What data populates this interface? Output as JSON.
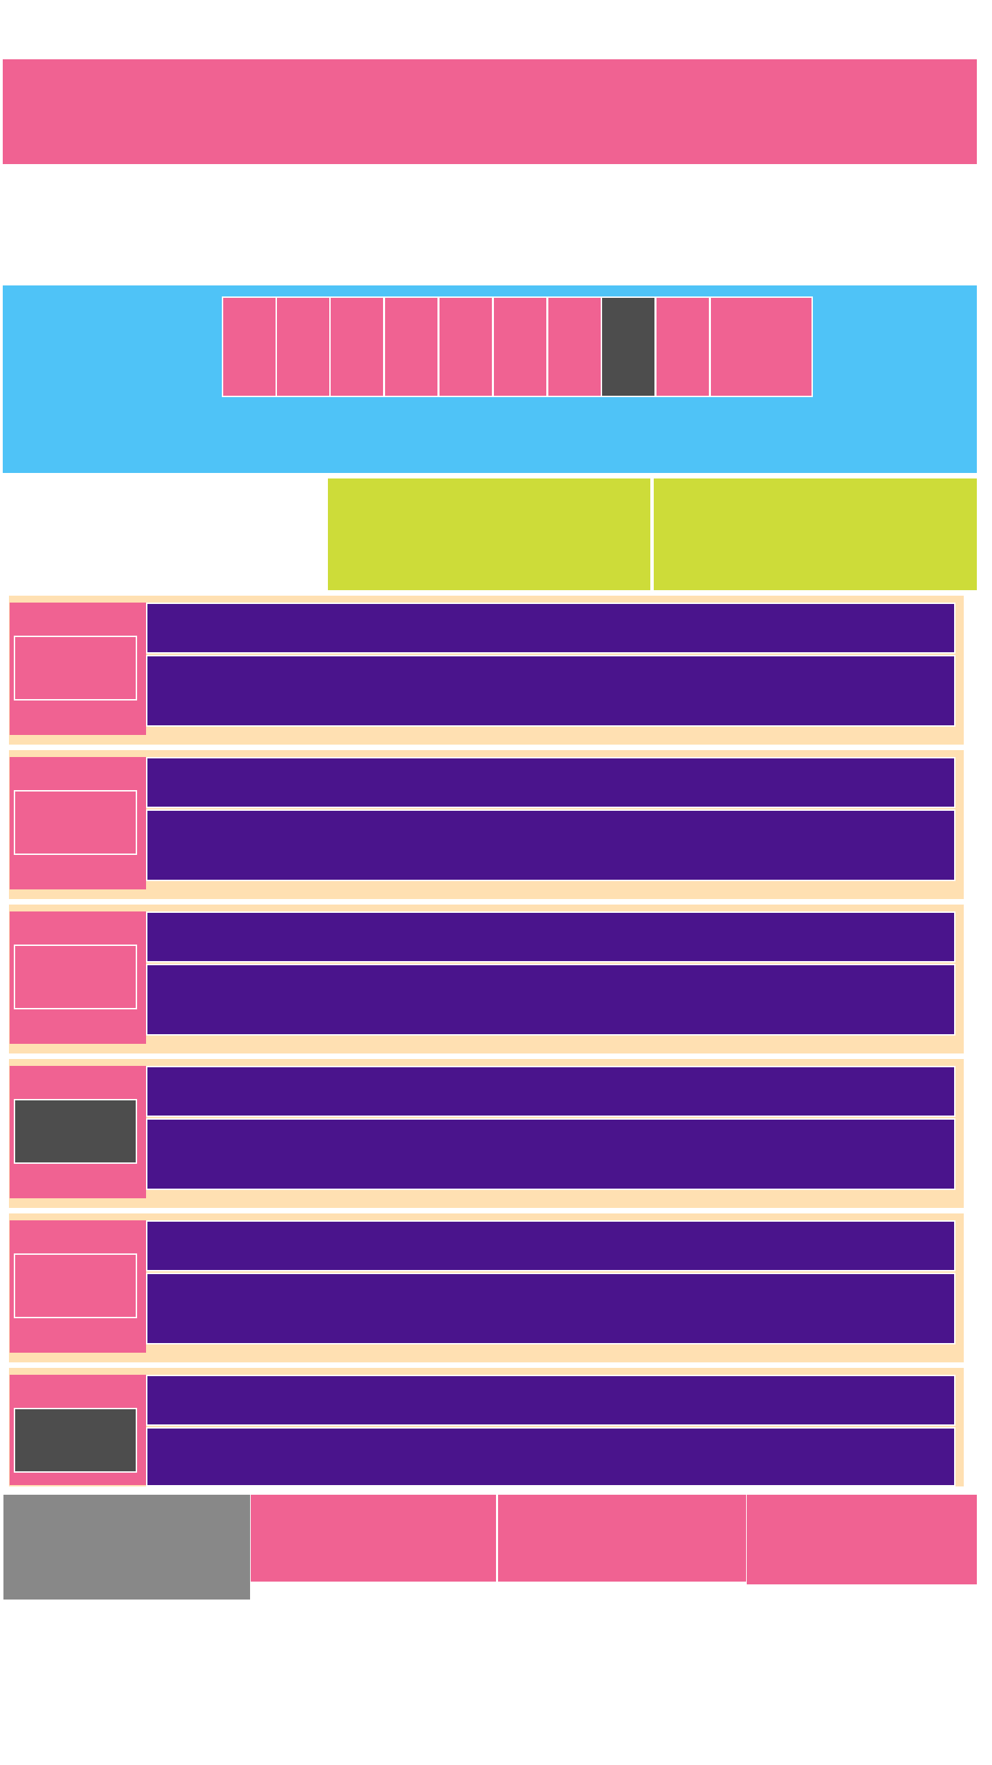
{
  "colors": {
    "pink": "#f06292",
    "sky": "#4fc3f7",
    "lime": "#cddc39",
    "peach": "#ffe0b2",
    "purple": "#4a148c",
    "dark": "#4d4d4d",
    "gray": "#888888"
  },
  "pagination": {
    "page_count": 10,
    "active_index": 7
  },
  "list": {
    "row_count": 6,
    "dark_thumb_rows": [
      3,
      5
    ]
  },
  "footer": {
    "card_count": 4
  }
}
